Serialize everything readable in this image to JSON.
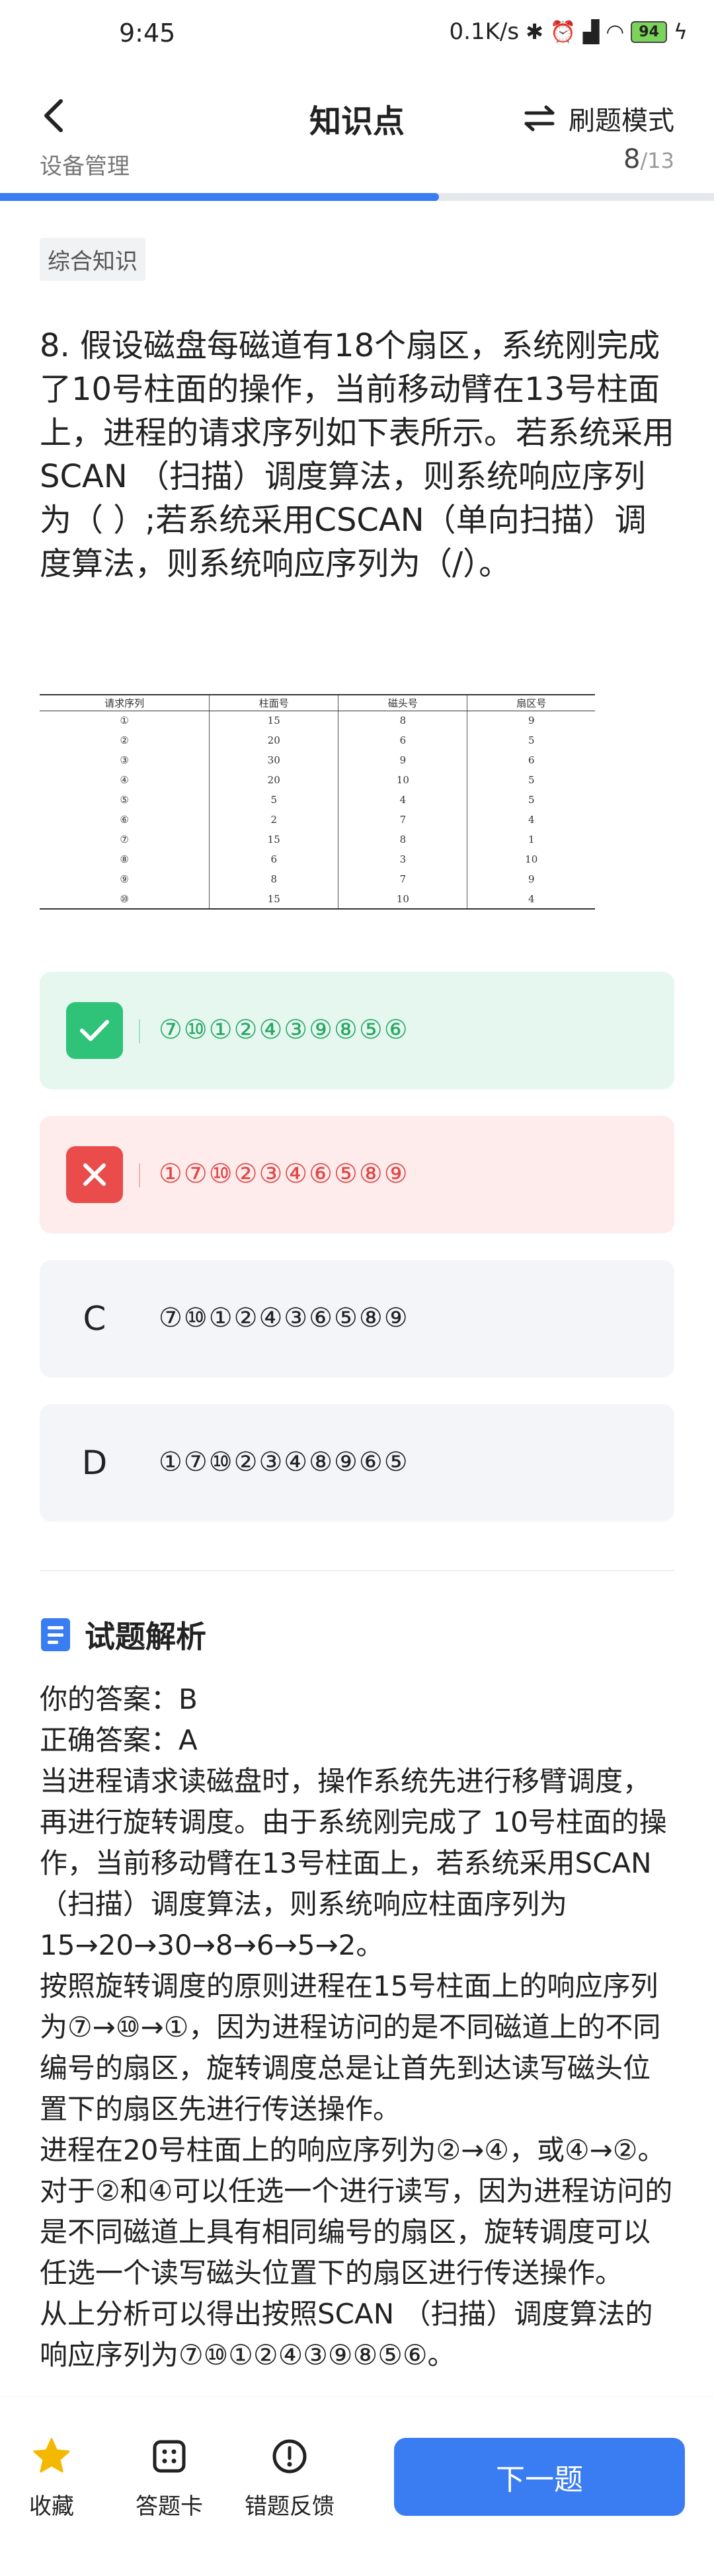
{
  "status_bar": {
    "time": "9:45",
    "network_speed": "0.1K/s",
    "battery": "94"
  },
  "nav": {
    "title": "知识点",
    "mode_label": "刷题模式"
  },
  "progress": {
    "category": "设备管理",
    "current": "8",
    "total": "/13",
    "fraction": 0.615
  },
  "tag": "综合知识",
  "question": {
    "text": "8. 假设磁盘每磁道有18个扇区，系统刚完成了10号柱面的操作，当前移动臂在13号柱面上，进程的请求序列如下表所示。若系统采用SCAN （扫描）调度算法，则系统响应序列为（ ）;若系统采用CSCAN（单向扫描）调度算法，则系统响应序列为（/）。",
    "table": {
      "headers": [
        "请求序列",
        "柱面号",
        "磁头号",
        "扇区号"
      ],
      "rows": [
        [
          "①",
          "15",
          "8",
          "9"
        ],
        [
          "②",
          "20",
          "6",
          "5"
        ],
        [
          "③",
          "30",
          "9",
          "6"
        ],
        [
          "④",
          "20",
          "10",
          "5"
        ],
        [
          "⑤",
          "5",
          "4",
          "5"
        ],
        [
          "⑥",
          "2",
          "7",
          "4"
        ],
        [
          "⑦",
          "15",
          "8",
          "1"
        ],
        [
          "⑧",
          "6",
          "3",
          "10"
        ],
        [
          "⑨",
          "8",
          "7",
          "9"
        ],
        [
          "⑩",
          "15",
          "10",
          "4"
        ]
      ]
    }
  },
  "options": [
    {
      "letter": "A",
      "text": "⑦⑩①②④③⑨⑧⑤⑥",
      "state": "correct"
    },
    {
      "letter": "B",
      "text": "①⑦⑩②③④⑥⑤⑧⑨",
      "state": "wrong"
    },
    {
      "letter": "C",
      "text": "⑦⑩①②④③⑥⑤⑧⑨",
      "state": "normal"
    },
    {
      "letter": "D",
      "text": "①⑦⑩②③④⑧⑨⑥⑤",
      "state": "normal"
    }
  ],
  "analysis": {
    "title": "试题解析",
    "your_answer": "你的答案：B",
    "correct_answer": "正确答案：A",
    "paragraphs": [
      "当进程请求读磁盘时，操作系统先进行移臂调度，再进行旋转调度。由于系统刚完成了 10号柱面的操作，当前移动臂在13号柱面上，若系统采用SCAN （扫描）调度算法，则系统响应柱面序列为15→20→30→8→6→5→2。",
      "按照旋转调度的原则进程在15号柱面上的响应序列为⑦→⑩→①，因为进程访问的是不同磁道上的不同编号的扇区，旋转调度总是让首先到达读写磁头位置下的扇区先进行传送操作。",
      "进程在20号柱面上的响应序列为②→④，或④→②。对于②和④可以任选一个进行读写，因为进程访问的是不同磁道上具有相同编号的扇区，旋转调度可以任选一个读写磁头位置下的扇区进行传送操作。",
      "从上分析可以得出按照SCAN （扫描）调度算法的响应序列为⑦⑩①②④③⑨⑧⑤⑥。"
    ]
  },
  "bottom_bar": {
    "favorite": "收藏",
    "answer_card": "答题卡",
    "feedback": "错题反馈",
    "next": "下一题"
  },
  "colors": {
    "accent": "#3a7cf2",
    "correct": "#2fc279",
    "wrong": "#ea4b4b",
    "star": "#f5b800"
  }
}
